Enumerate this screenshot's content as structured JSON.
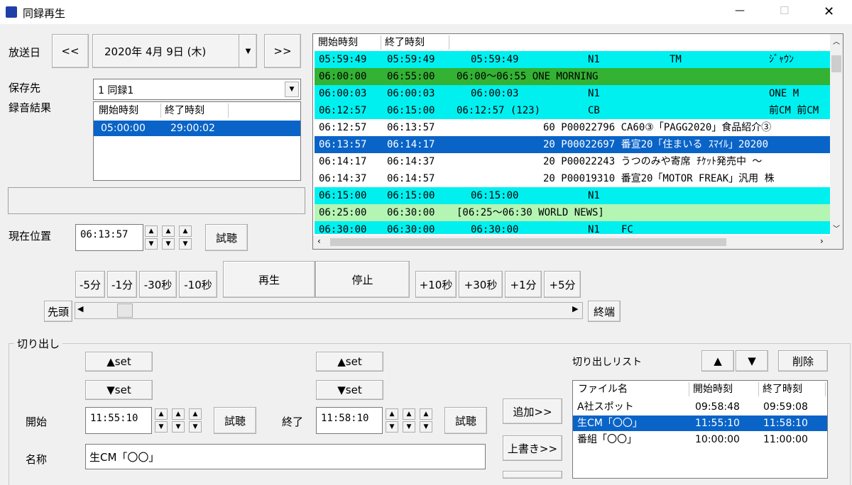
{
  "window": {
    "title": "同録再生",
    "minimize": "—",
    "maximize": "☐",
    "close": "✕"
  },
  "broadcast": {
    "label": "放送日",
    "prev": "<<",
    "next": ">>",
    "date": "2020年 4月 9日 (木)"
  },
  "save": {
    "label": "保存先",
    "value": "1 同録1"
  },
  "result": {
    "label": "録音結果",
    "headers": [
      "開始時刻",
      "終了時刻"
    ],
    "rows": [
      {
        "start": "05:00:00",
        "end": "29:00:02"
      }
    ]
  },
  "position": {
    "label": "現在位置",
    "value": "06:13:57",
    "listen": "試聴"
  },
  "transport": {
    "back": [
      "-5分",
      "-1分",
      "-30秒",
      "-10秒"
    ],
    "play": "再生",
    "stop": "停止",
    "fwd": [
      "+10秒",
      "+30秒",
      "+1分",
      "+5分"
    ],
    "start": "先頭",
    "end": "終端",
    "slider_fraction": 0.06
  },
  "log": {
    "headers": [
      "開始時刻",
      "終了時刻"
    ],
    "rows": [
      {
        "start": "05:59:49",
        "end": "05:59:49",
        "c3": "05:59:49",
        "c4": "N1",
        "c5": "TM",
        "c6": "ｼﾞｬｳﾝ",
        "bg": "#00f0f0",
        "fg": "#000",
        "sel": false
      },
      {
        "start": "06:00:00",
        "end": "06:55:00",
        "c3": "06:00～06:55 ONE MORNING",
        "c4": "",
        "c5": "",
        "c6": "",
        "bg": "#33b233",
        "fg": "#000",
        "sel": false
      },
      {
        "start": "06:00:03",
        "end": "06:00:03",
        "c3": "06:00:03",
        "c4": "N1",
        "c5": "",
        "c6": "ONE M",
        "bg": "#00f0f0",
        "fg": "#000",
        "sel": false
      },
      {
        "start": "06:12:57",
        "end": "06:15:00",
        "c3": "06:12:57 (123)",
        "c4": "CB",
        "c5": "",
        "c6": "前CM 前CM",
        "bg": "#00f0f0",
        "fg": "#000",
        "sel": false
      },
      {
        "start": "06:12:57",
        "end": "06:13:57",
        "c3": "",
        "c4": "60 P00022796 CA60③「PAGG2020」食品紹介③",
        "c5": "",
        "c6": "",
        "bg": "#ffffff",
        "fg": "#000",
        "sel": false
      },
      {
        "start": "06:13:57",
        "end": "06:14:17",
        "c3": "",
        "c4": "20 P00022697 番宣20「住まいる ｽﾏｲﾙ」20200",
        "c5": "",
        "c6": "",
        "bg": "#0a64c8",
        "fg": "#fff",
        "sel": true
      },
      {
        "start": "06:14:17",
        "end": "06:14:37",
        "c3": "",
        "c4": "20 P00022243 うつのみや寄席 ﾁｹｯﾄ発売中 ～",
        "c5": "",
        "c6": "",
        "bg": "#ffffff",
        "fg": "#000",
        "sel": false
      },
      {
        "start": "06:14:37",
        "end": "06:14:57",
        "c3": "",
        "c4": "20 P00019310 番宣20「MOTOR FREAK」汎用 株",
        "c5": "",
        "c6": "",
        "bg": "#ffffff",
        "fg": "#000",
        "sel": false
      },
      {
        "start": "06:15:00",
        "end": "06:15:00",
        "c3": "06:15:00",
        "c4": "N1",
        "c5": "",
        "c6": "",
        "bg": "#00f0f0",
        "fg": "#000",
        "sel": false
      },
      {
        "start": "06:25:00",
        "end": "06:30:00",
        "c3": "[06:25～06:30 WORLD NEWS]",
        "c4": "",
        "c5": "",
        "c6": "",
        "bg": "#b4f5b4",
        "fg": "#000",
        "sel": false
      },
      {
        "start": "06:30:00",
        "end": "06:30:00",
        "c3": "06:30:00",
        "c4": "N1",
        "c5": "FC",
        "c6": "",
        "bg": "#00f0f0",
        "fg": "#000",
        "sel": false
      }
    ]
  },
  "clip": {
    "legend": "切り出し",
    "set_up": "▲set",
    "set_down": "▼set",
    "start_label": "開始",
    "start_value": "11:55:10",
    "end_label": "終了",
    "end_value": "11:58:10",
    "listen": "試聴",
    "name_label": "名称",
    "name_value": "生CM「〇〇」",
    "add": "追加>>",
    "overwrite": "上書き>>"
  },
  "cliplist": {
    "label": "切り出しリスト",
    "up": "▲",
    "down": "▼",
    "delete": "削除",
    "headers": [
      "ファイル名",
      "開始時刻",
      "終了時刻"
    ],
    "rows": [
      {
        "name": "A社スポット",
        "start": "09:58:48",
        "end": "09:59:08",
        "sel": false
      },
      {
        "name": "生CM「〇〇」",
        "start": "11:55:10",
        "end": "11:58:10",
        "sel": true
      },
      {
        "name": "番組「〇〇」",
        "start": "10:00:00",
        "end": "11:00:00",
        "sel": false
      }
    ]
  }
}
